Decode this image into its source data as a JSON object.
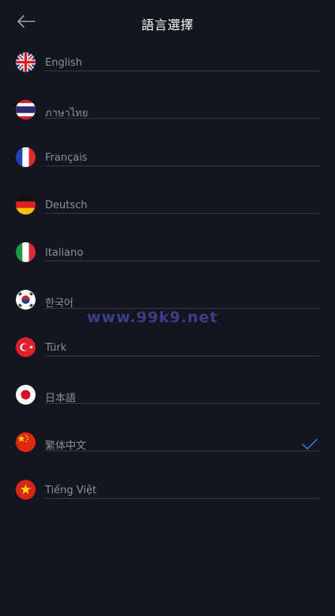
{
  "header": {
    "title": "語言選擇",
    "back_icon": "arrow-left-icon"
  },
  "languages": [
    {
      "label": "English",
      "flag": "uk-flag-icon",
      "selected": false
    },
    {
      "label": "ภาษาไทย",
      "flag": "thailand-flag-icon",
      "selected": false
    },
    {
      "label": "Français",
      "flag": "france-flag-icon",
      "selected": false
    },
    {
      "label": "Deutsch",
      "flag": "germany-flag-icon",
      "selected": false
    },
    {
      "label": "Italiano",
      "flag": "italy-flag-icon",
      "selected": false
    },
    {
      "label": "한국어",
      "flag": "korea-flag-icon",
      "selected": false
    },
    {
      "label": "Türk",
      "flag": "turkey-flag-icon",
      "selected": false
    },
    {
      "label": "日本語",
      "flag": "japan-flag-icon",
      "selected": false
    },
    {
      "label": "繁体中文",
      "flag": "china-flag-icon",
      "selected": true
    },
    {
      "label": "Tiếng Việt",
      "flag": "vietnam-flag-icon",
      "selected": false
    }
  ],
  "watermark": "www.99k9.net",
  "colors": {
    "background": "#14161f",
    "label": "#8a8e9e",
    "divider": "#343846",
    "check": "#2f6fe6",
    "watermark": "#3a3f8c"
  }
}
